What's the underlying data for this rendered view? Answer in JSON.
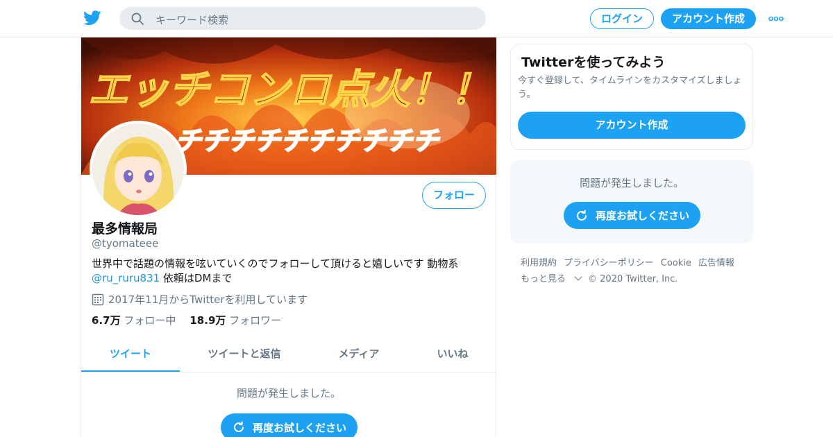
{
  "nav": {
    "search_placeholder": "キーワード検索",
    "login_label": "ログイン",
    "signup_label": "アカウント作成"
  },
  "banner": {
    "headline": "エッチコンロ点火！！",
    "subline": "チチチチチチチチチチ"
  },
  "profile": {
    "display_name": "最多情報局",
    "handle": "@tyomateee",
    "bio_text": "世界中で話題の情報を呟いていくのでフォローして頂けると嬉しいです 動物系",
    "bio_mention": "@ru_ruru831",
    "bio_suffix": " 依頼はDMまで",
    "joined": "2017年11月からTwitterを利用しています",
    "following_count": "6.7万",
    "following_label": "フォロー中",
    "followers_count": "18.9万",
    "followers_label": "フォロワー",
    "follow_button": "フォロー"
  },
  "tabs": [
    {
      "label": "ツイート",
      "active": true
    },
    {
      "label": "ツイートと返信",
      "active": false
    },
    {
      "label": "メディア",
      "active": false
    },
    {
      "label": "いいね",
      "active": false
    }
  ],
  "timeline": {
    "error_text": "問題が発生しました。",
    "retry_label": "再度お試しください"
  },
  "sidebar": {
    "signup_card": {
      "title": "Twitterを使ってみよう",
      "description": "今すぐ登録して、タイムラインをカスタマイズしましょう。",
      "button": "アカウント作成"
    },
    "error_box": {
      "error_text": "問題が発生しました。",
      "retry_label": "再度お試しください"
    },
    "footer": {
      "links": [
        "利用規約",
        "プライバシーポリシー",
        "Cookie",
        "広告情報"
      ],
      "more": "もっと見る",
      "copyright": "© 2020 Twitter, Inc."
    }
  },
  "colors": {
    "accent": "#1da1f2",
    "text_secondary": "#657786",
    "border": "#e6ecf0"
  },
  "icons": [
    "twitter-bird-icon",
    "search-icon",
    "more-icon",
    "calendar-icon",
    "refresh-icon",
    "chevron-down-icon"
  ]
}
